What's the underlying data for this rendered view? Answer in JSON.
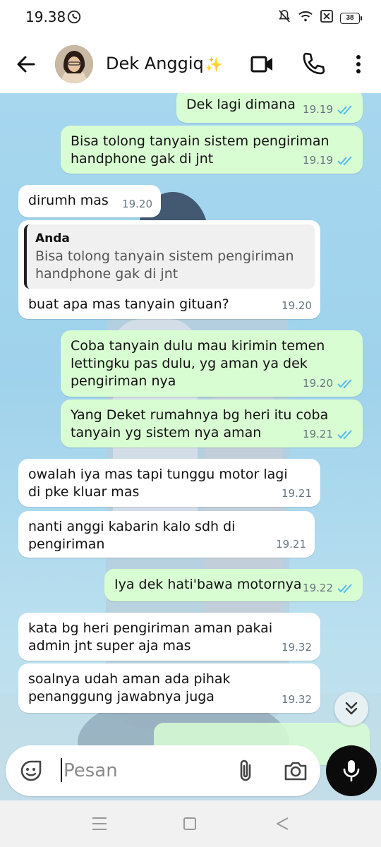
{
  "status": {
    "time": "19.38",
    "battery": "38"
  },
  "header": {
    "contact_name": "Dek Anggiq",
    "name_suffix": "✨"
  },
  "messages": [
    {
      "dir": "out",
      "text": "Dek lagi dimana",
      "time": "19.19"
    },
    {
      "dir": "out",
      "text": "Bisa tolong tanyain sistem pengiriman handphone gak di jnt",
      "time": "19.19"
    },
    {
      "dir": "in",
      "text": "dirumh mas",
      "time": "19.20"
    },
    {
      "dir": "in",
      "quote_author": "Anda",
      "quote_text": "Bisa tolong tanyain sistem pengiriman handphone gak di jnt",
      "text": "buat apa mas tanyain gituan?",
      "time": "19.20"
    },
    {
      "dir": "out",
      "text": "Coba tanyain dulu mau kirimin temen lettingku pas dulu, yg aman ya dek pengiriman nya",
      "time": "19.20"
    },
    {
      "dir": "out",
      "text": "Yang Deket rumahnya bg heri itu coba tanyain yg sistem nya aman",
      "time": "19.21"
    },
    {
      "dir": "in",
      "text": "owalah iya mas tapi tunggu motor lagi di pke kluar mas",
      "time": "19.21"
    },
    {
      "dir": "in",
      "text": "nanti anggi kabarin kalo sdh di pengiriman",
      "time": "19.21"
    },
    {
      "dir": "out",
      "text": "Iya dek hati'bawa motornya",
      "time": "19.22"
    },
    {
      "dir": "in",
      "text": "kata bg heri pengiriman aman pakai admin jnt super aja mas",
      "time": "19.32"
    },
    {
      "dir": "in",
      "text": "soalnya udah aman ada pihak penanggung jawabnya juga",
      "time": "19.32"
    }
  ],
  "composer": {
    "placeholder": "Pesan",
    "value": ""
  },
  "colors": {
    "outgoing_bubble": "#d9fdd3",
    "incoming_bubble": "#ffffff",
    "read_ticks": "#53bdeb",
    "chat_background": "#a6d7ef"
  },
  "icons": {
    "back": "arrow-left-icon",
    "video": "video-call-icon",
    "call": "phone-icon",
    "menu": "more-vert-icon",
    "emoji": "sticker-icon",
    "attach": "paperclip-icon",
    "camera": "camera-icon",
    "mic": "microphone-icon",
    "scroll": "double-chevron-down-icon"
  }
}
